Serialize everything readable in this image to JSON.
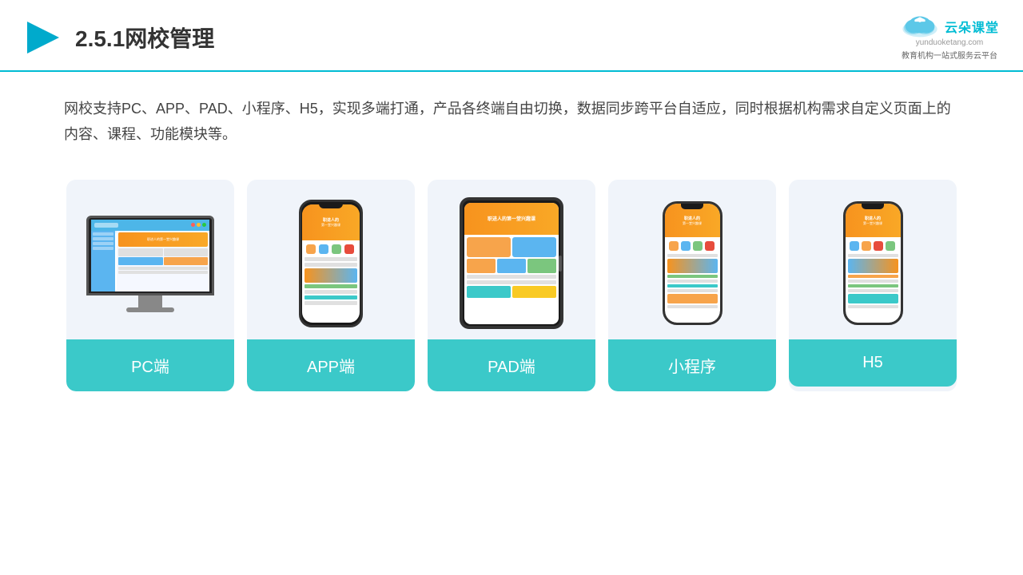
{
  "header": {
    "title": "2.5.1网校管理",
    "brand": {
      "name": "云朵课堂",
      "url": "yunduoketang.com",
      "subtitle": "教育机构一站\n式服务云平台"
    }
  },
  "description": "网校支持PC、APP、PAD、小程序、H5，实现多端打通，产品各终端自由切换，数据同步跨平台自适应，同时根据机构需求自定义页面上的内容、课程、功能模块等。",
  "cards": [
    {
      "id": "pc",
      "label": "PC端",
      "device": "pc"
    },
    {
      "id": "app",
      "label": "APP端",
      "device": "phone"
    },
    {
      "id": "pad",
      "label": "PAD端",
      "device": "tablet"
    },
    {
      "id": "miniapp",
      "label": "小程序",
      "device": "miniphone"
    },
    {
      "id": "h5",
      "label": "H5",
      "device": "miniphone2"
    }
  ],
  "colors": {
    "accent": "#3bc9c9",
    "border": "#00bcd4",
    "text": "#444"
  }
}
